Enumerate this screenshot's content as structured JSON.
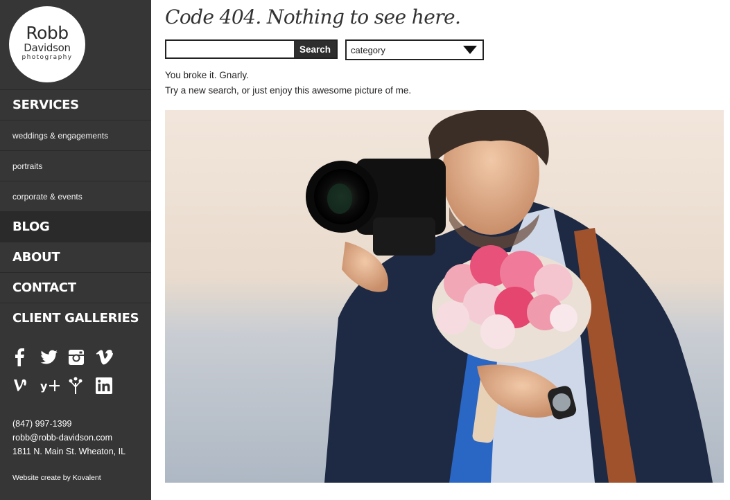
{
  "logo": {
    "line1": "Robb",
    "line2": "Davidson",
    "line3": "photography"
  },
  "nav": {
    "services": "SERVICES",
    "weddings": "weddings & engagements",
    "portraits": "portraits",
    "corporate": "corporate & events",
    "blog": "BLOG",
    "about": "ABOUT",
    "contact": "CONTACT",
    "galleries": "CLIENT GALLERIES"
  },
  "social": {
    "icons": [
      "facebook-icon",
      "twitter-icon",
      "instagram-icon",
      "vimeo-icon",
      "vine-icon",
      "yelp-icon",
      "wedding-wire-icon",
      "linkedin-icon"
    ]
  },
  "contact": {
    "phone": "(847) 997-1399",
    "email": "robb@robb-davidson.com",
    "address": "1811 N. Main St. Wheaton, IL"
  },
  "credit": "Website create by Kovalent",
  "main": {
    "title": "Code 404. Nothing to see here.",
    "search_placeholder": "",
    "search_value": "",
    "search_label": "Search",
    "category_selected": "category",
    "message_line1": "You broke it. Gnarly.",
    "message_line2": "Try a new search, or just enjoy this awesome picture of me."
  },
  "colors": {
    "sidebar_bg": "#363636",
    "sidebar_active": "#2a2a2a",
    "text_dark": "#333333",
    "button_bg": "#2e2e2e"
  }
}
